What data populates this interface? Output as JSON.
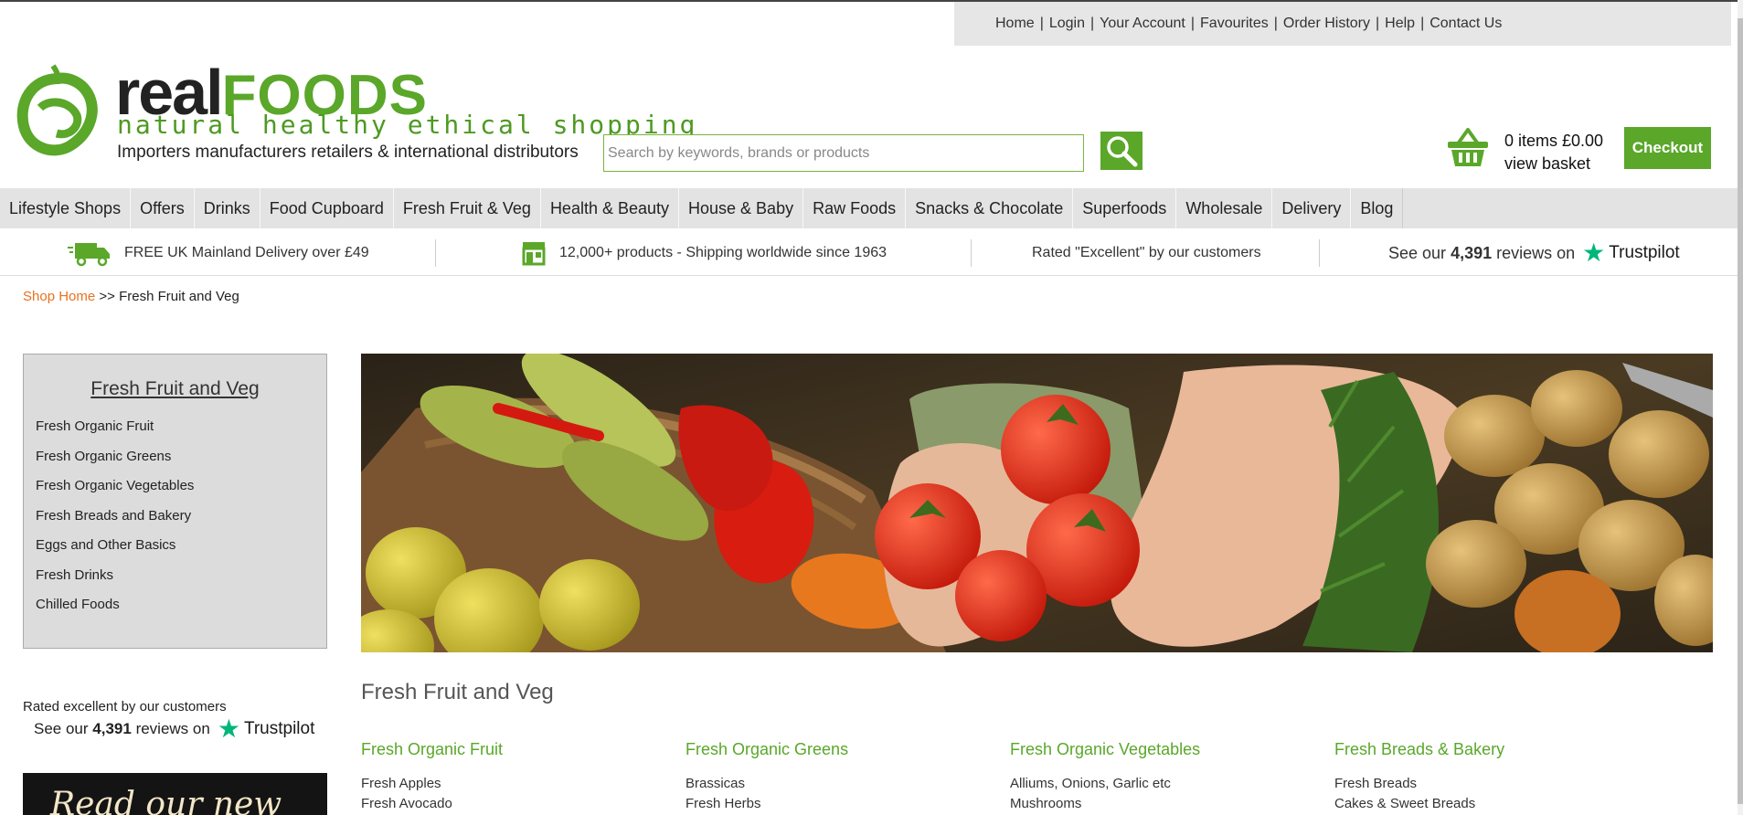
{
  "top_links": [
    "Home",
    "Login",
    "Your Account",
    "Favourites",
    "Order History",
    "Help",
    "Contact Us"
  ],
  "logo": {
    "word_real": "real",
    "word_foods": "FOODS",
    "tagline": "natural healthy ethical shopping",
    "subline": "Importers manufacturers retailers & international distributors"
  },
  "search": {
    "placeholder": "Search by keywords, brands or products"
  },
  "basket": {
    "items": "0 items £0.00",
    "view": "view basket"
  },
  "checkout_label": "Checkout",
  "nav": [
    "Lifestyle Shops",
    "Offers",
    "Drinks",
    "Food Cupboard",
    "Fresh Fruit & Veg",
    "Health & Beauty",
    "House & Baby",
    "Raw Foods",
    "Snacks & Chocolate",
    "Superfoods",
    "Wholesale",
    "Delivery",
    "Blog"
  ],
  "info": {
    "delivery": "FREE UK Mainland Delivery over £49",
    "products": "12,000+ products - Shipping worldwide since 1963",
    "rated": "Rated \"Excellent\" by our customers",
    "reviews_pre": "See our",
    "reviews_count": "4,391",
    "reviews_post": "reviews on",
    "trustpilot": "Trustpilot"
  },
  "breadcrumb": {
    "home": "Shop Home",
    "sep": ">>",
    "current": "Fresh Fruit and Veg"
  },
  "sidebar": {
    "title": "Fresh Fruit and Veg",
    "items": [
      "Fresh Organic Fruit",
      "Fresh Organic Greens",
      "Fresh Organic Vegetables",
      "Fresh Breads and Bakery",
      "Eggs and Other Basics",
      "Fresh Drinks",
      "Chilled Foods"
    ],
    "rated": "Rated excellent by our customers"
  },
  "promo_text": "Read our new",
  "section_title": "Fresh Fruit and Veg",
  "categories": [
    {
      "title": "Fresh Organic Fruit",
      "items": [
        "Fresh Apples",
        "Fresh Avocado"
      ]
    },
    {
      "title": "Fresh Organic Greens",
      "items": [
        "Brassicas",
        "Fresh Herbs"
      ]
    },
    {
      "title": "Fresh Organic Vegetables",
      "items": [
        "Alliums, Onions, Garlic etc",
        "Mushrooms"
      ]
    },
    {
      "title": "Fresh Breads & Bakery",
      "items": [
        "Fresh Breads",
        "Cakes & Sweet Breads"
      ]
    }
  ],
  "colors": {
    "brand_green": "#5aa72a",
    "breadcrumb_orange": "#e8711f",
    "trustpilot_green": "#00b67a",
    "nav_bg": "#e3e3e3"
  }
}
